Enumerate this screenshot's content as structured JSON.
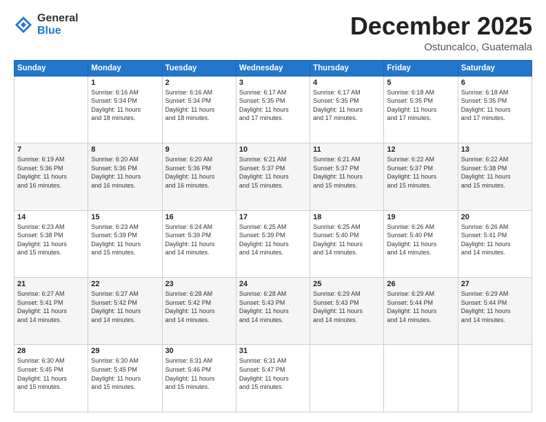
{
  "logo": {
    "general": "General",
    "blue": "Blue"
  },
  "header": {
    "month": "December 2025",
    "location": "Ostuncalco, Guatemala"
  },
  "weekdays": [
    "Sunday",
    "Monday",
    "Tuesday",
    "Wednesday",
    "Thursday",
    "Friday",
    "Saturday"
  ],
  "weeks": [
    [
      {
        "day": "",
        "info": ""
      },
      {
        "day": "1",
        "info": "Sunrise: 6:16 AM\nSunset: 5:34 PM\nDaylight: 11 hours\nand 18 minutes."
      },
      {
        "day": "2",
        "info": "Sunrise: 6:16 AM\nSunset: 5:34 PM\nDaylight: 11 hours\nand 18 minutes."
      },
      {
        "day": "3",
        "info": "Sunrise: 6:17 AM\nSunset: 5:35 PM\nDaylight: 11 hours\nand 17 minutes."
      },
      {
        "day": "4",
        "info": "Sunrise: 6:17 AM\nSunset: 5:35 PM\nDaylight: 11 hours\nand 17 minutes."
      },
      {
        "day": "5",
        "info": "Sunrise: 6:18 AM\nSunset: 5:35 PM\nDaylight: 11 hours\nand 17 minutes."
      },
      {
        "day": "6",
        "info": "Sunrise: 6:18 AM\nSunset: 5:35 PM\nDaylight: 11 hours\nand 17 minutes."
      }
    ],
    [
      {
        "day": "7",
        "info": "Sunrise: 6:19 AM\nSunset: 5:36 PM\nDaylight: 11 hours\nand 16 minutes."
      },
      {
        "day": "8",
        "info": "Sunrise: 6:20 AM\nSunset: 5:36 PM\nDaylight: 11 hours\nand 16 minutes."
      },
      {
        "day": "9",
        "info": "Sunrise: 6:20 AM\nSunset: 5:36 PM\nDaylight: 11 hours\nand 16 minutes."
      },
      {
        "day": "10",
        "info": "Sunrise: 6:21 AM\nSunset: 5:37 PM\nDaylight: 11 hours\nand 15 minutes."
      },
      {
        "day": "11",
        "info": "Sunrise: 6:21 AM\nSunset: 5:37 PM\nDaylight: 11 hours\nand 15 minutes."
      },
      {
        "day": "12",
        "info": "Sunrise: 6:22 AM\nSunset: 5:37 PM\nDaylight: 11 hours\nand 15 minutes."
      },
      {
        "day": "13",
        "info": "Sunrise: 6:22 AM\nSunset: 5:38 PM\nDaylight: 11 hours\nand 15 minutes."
      }
    ],
    [
      {
        "day": "14",
        "info": "Sunrise: 6:23 AM\nSunset: 5:38 PM\nDaylight: 11 hours\nand 15 minutes."
      },
      {
        "day": "15",
        "info": "Sunrise: 6:23 AM\nSunset: 5:39 PM\nDaylight: 11 hours\nand 15 minutes."
      },
      {
        "day": "16",
        "info": "Sunrise: 6:24 AM\nSunset: 5:39 PM\nDaylight: 11 hours\nand 14 minutes."
      },
      {
        "day": "17",
        "info": "Sunrise: 6:25 AM\nSunset: 5:39 PM\nDaylight: 11 hours\nand 14 minutes."
      },
      {
        "day": "18",
        "info": "Sunrise: 6:25 AM\nSunset: 5:40 PM\nDaylight: 11 hours\nand 14 minutes."
      },
      {
        "day": "19",
        "info": "Sunrise: 6:26 AM\nSunset: 5:40 PM\nDaylight: 11 hours\nand 14 minutes."
      },
      {
        "day": "20",
        "info": "Sunrise: 6:26 AM\nSunset: 5:41 PM\nDaylight: 11 hours\nand 14 minutes."
      }
    ],
    [
      {
        "day": "21",
        "info": "Sunrise: 6:27 AM\nSunset: 5:41 PM\nDaylight: 11 hours\nand 14 minutes."
      },
      {
        "day": "22",
        "info": "Sunrise: 6:27 AM\nSunset: 5:42 PM\nDaylight: 11 hours\nand 14 minutes."
      },
      {
        "day": "23",
        "info": "Sunrise: 6:28 AM\nSunset: 5:42 PM\nDaylight: 11 hours\nand 14 minutes."
      },
      {
        "day": "24",
        "info": "Sunrise: 6:28 AM\nSunset: 5:43 PM\nDaylight: 11 hours\nand 14 minutes."
      },
      {
        "day": "25",
        "info": "Sunrise: 6:29 AM\nSunset: 5:43 PM\nDaylight: 11 hours\nand 14 minutes."
      },
      {
        "day": "26",
        "info": "Sunrise: 6:29 AM\nSunset: 5:44 PM\nDaylight: 11 hours\nand 14 minutes."
      },
      {
        "day": "27",
        "info": "Sunrise: 6:29 AM\nSunset: 5:44 PM\nDaylight: 11 hours\nand 14 minutes."
      }
    ],
    [
      {
        "day": "28",
        "info": "Sunrise: 6:30 AM\nSunset: 5:45 PM\nDaylight: 11 hours\nand 15 minutes."
      },
      {
        "day": "29",
        "info": "Sunrise: 6:30 AM\nSunset: 5:45 PM\nDaylight: 11 hours\nand 15 minutes."
      },
      {
        "day": "30",
        "info": "Sunrise: 6:31 AM\nSunset: 5:46 PM\nDaylight: 11 hours\nand 15 minutes."
      },
      {
        "day": "31",
        "info": "Sunrise: 6:31 AM\nSunset: 5:47 PM\nDaylight: 11 hours\nand 15 minutes."
      },
      {
        "day": "",
        "info": ""
      },
      {
        "day": "",
        "info": ""
      },
      {
        "day": "",
        "info": ""
      }
    ]
  ]
}
